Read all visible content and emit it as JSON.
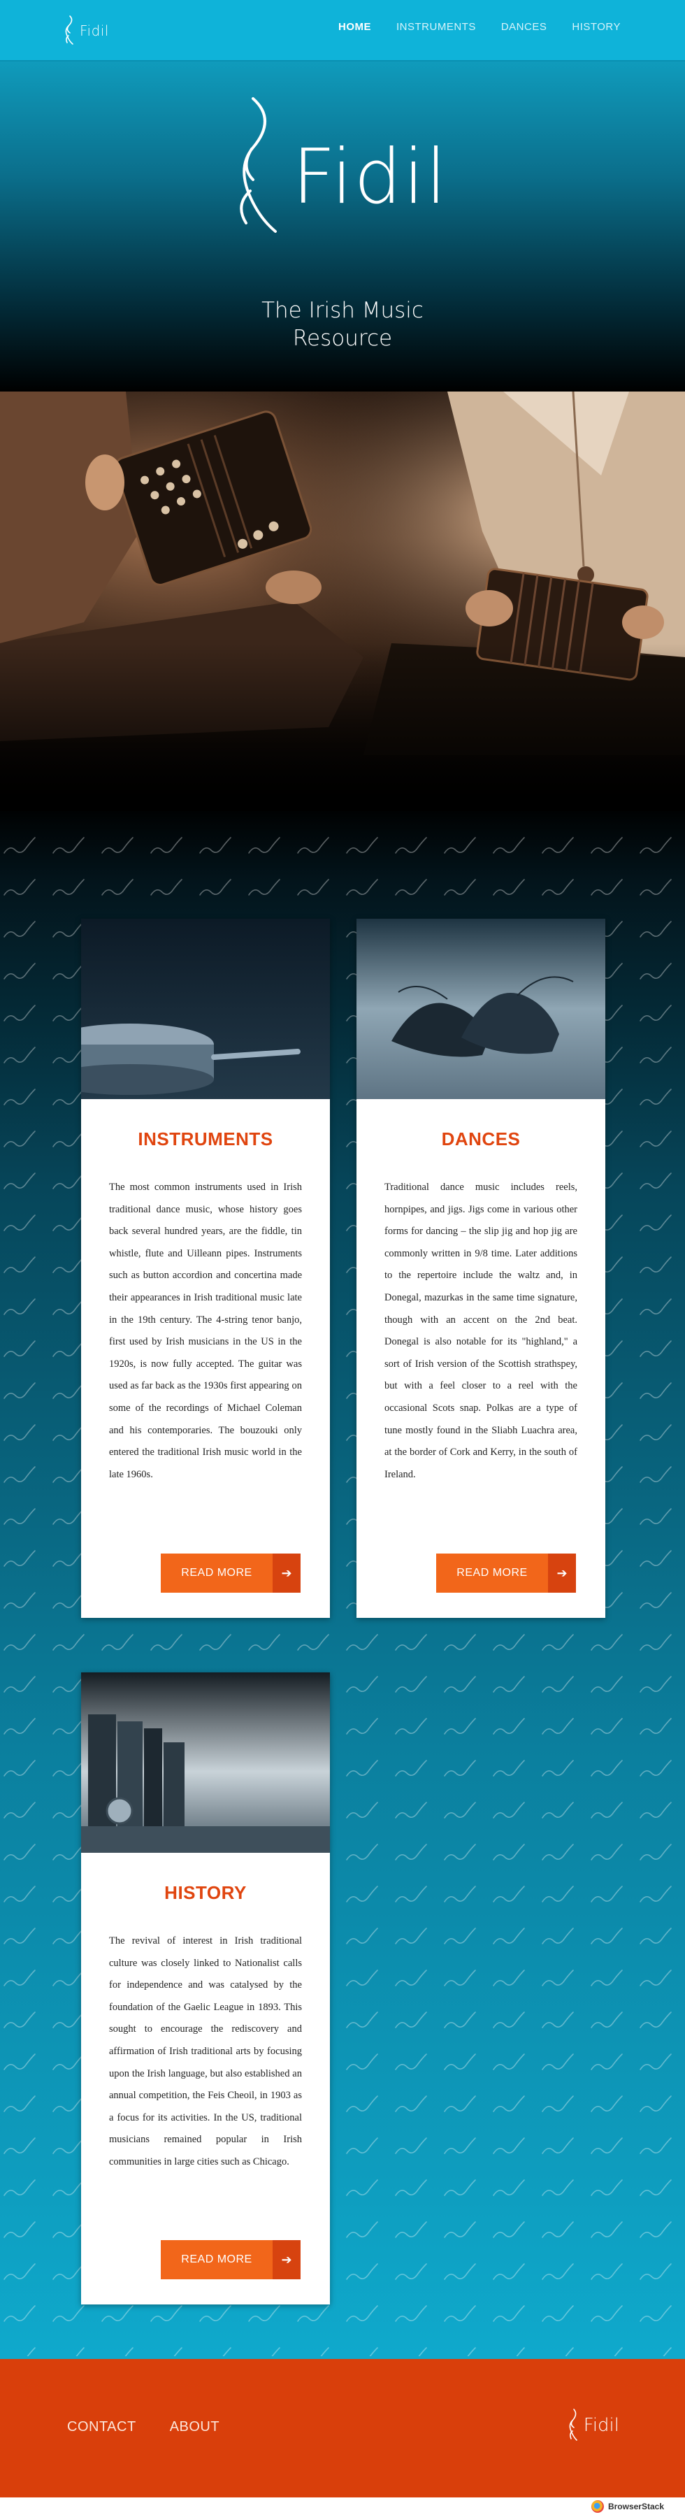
{
  "brand": {
    "name": "Fidil",
    "tagline": "The Irish Music Resource"
  },
  "nav": {
    "items": [
      {
        "label": "HOME",
        "active": true
      },
      {
        "label": "INSTRUMENTS",
        "active": false
      },
      {
        "label": "DANCES",
        "active": false
      },
      {
        "label": "HISTORY",
        "active": false
      }
    ]
  },
  "cards": {
    "instruments": {
      "title": "INSTRUMENTS",
      "body": "The most common instruments used in Irish traditional dance music, whose history goes back several hundred years, are the fiddle, tin whistle, flute and Uilleann pipes. Instruments such as button accordion and concertina made their appearances in Irish traditional music late in the 19th century. The 4-string tenor banjo, first used by Irish musicians in the US in the 1920s, is now fully accepted. The guitar was used as far back as the 1930s first appearing on some of the recordings of Michael Coleman and his contemporaries. The bouzouki only entered the traditional Irish music world in the late 1960s.",
      "button": "READ MORE"
    },
    "dances": {
      "title": "DANCES",
      "body": "Traditional dance music includes reels, hornpipes, and jigs. Jigs come in various other forms for dancing – the slip jig and hop jig are commonly written in 9/8 time. Later additions to the repertoire include the waltz and, in Donegal, mazurkas in the same time signature, though with an accent on the 2nd beat. Donegal is also notable for its \"highland,\" a sort of Irish version of the Scottish strathspey, but with a feel closer to a reel with the occasional Scots snap. Polkas are a type of tune mostly found in the Sliabh Luachra area, at the border of Cork and Kerry, in the south of Ireland.",
      "button": "READ MORE"
    },
    "history": {
      "title": "HISTORY",
      "body": "The revival of interest in Irish traditional culture was closely linked to Nationalist calls for independence and was catalysed by the foundation of the Gaelic League in 1893. This sought to encourage the rediscovery and affirmation of Irish traditional arts by focusing upon the Irish language, but also established an annual competition, the Feis Cheoil, in 1903 as a focus for its activities. In the US, traditional musicians remained popular in Irish communities in large cities such as Chicago.",
      "button": "READ MORE"
    }
  },
  "footer": {
    "links": [
      "CONTACT",
      "ABOUT"
    ]
  },
  "watermark": {
    "label": "BrowserStack"
  },
  "colors": {
    "accent": "#f2661a",
    "accent_dark": "#d7430f",
    "title": "#e0450f",
    "nav_bg": "#0fb3d9",
    "footer_bg": "#d93f0b"
  },
  "icons": {
    "arrow": "arrow-right-icon",
    "logo": "treble-clef-logo-icon"
  }
}
